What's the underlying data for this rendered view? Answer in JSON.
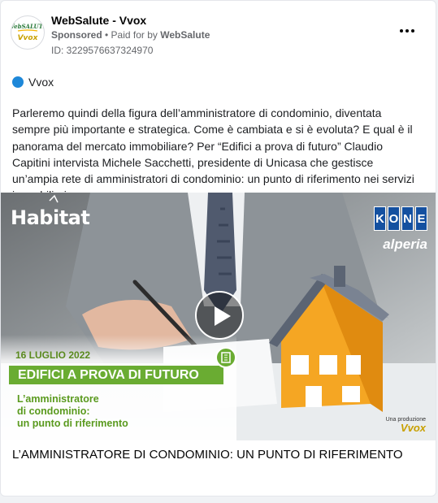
{
  "post": {
    "page_name": "WebSalute - Vvox",
    "sponsored_label": "Sponsored",
    "paid_for_prefix": "• Paid for by",
    "paid_for_name": "WebSalute",
    "ad_id": "ID: 3229576637324970",
    "platform_label": "Vvox",
    "body_text": "Parleremo quindi della figura dell’amministratore di condominio, diventata sempre più importante e strategica. Come è cambiata e si è evoluta? E qual è il panorama del mercato immobiliare? Per “Edifici a prova di futuro” Claudio Capitini intervista Michele Sacchetti, presidente di Unicasa che gestisce un’ampia rete di amministratori di condominio: un punto di riferimento nei servizi immobiliari…",
    "caption": "L’AMMINISTRATORE DI CONDOMINIO: UN PUNTO DI RIFERIMENTO"
  },
  "avatar": {
    "text_top": "WebSALUTE",
    "text_bottom": "Vvox"
  },
  "media": {
    "brand": "Habitat",
    "kone_letters": [
      "K",
      "O",
      "N",
      "E"
    ],
    "alperia": "alperia",
    "date": "16 LUGLIO 2022",
    "banner": "EDIFICI A PROVA DI FUTURO",
    "subtitle_lines": [
      "L’amministratore",
      "di condominio:",
      "un punto di riferimento"
    ],
    "production_label": "Una produzione",
    "production_brand": "Vvox"
  },
  "icons": {
    "more": "more-options-icon",
    "play": "play-icon",
    "platform": "platform-dot-icon"
  },
  "colors": {
    "accent_green": "#6aac32",
    "kone_blue": "#1450a0",
    "platform_blue": "#1e88d9"
  }
}
